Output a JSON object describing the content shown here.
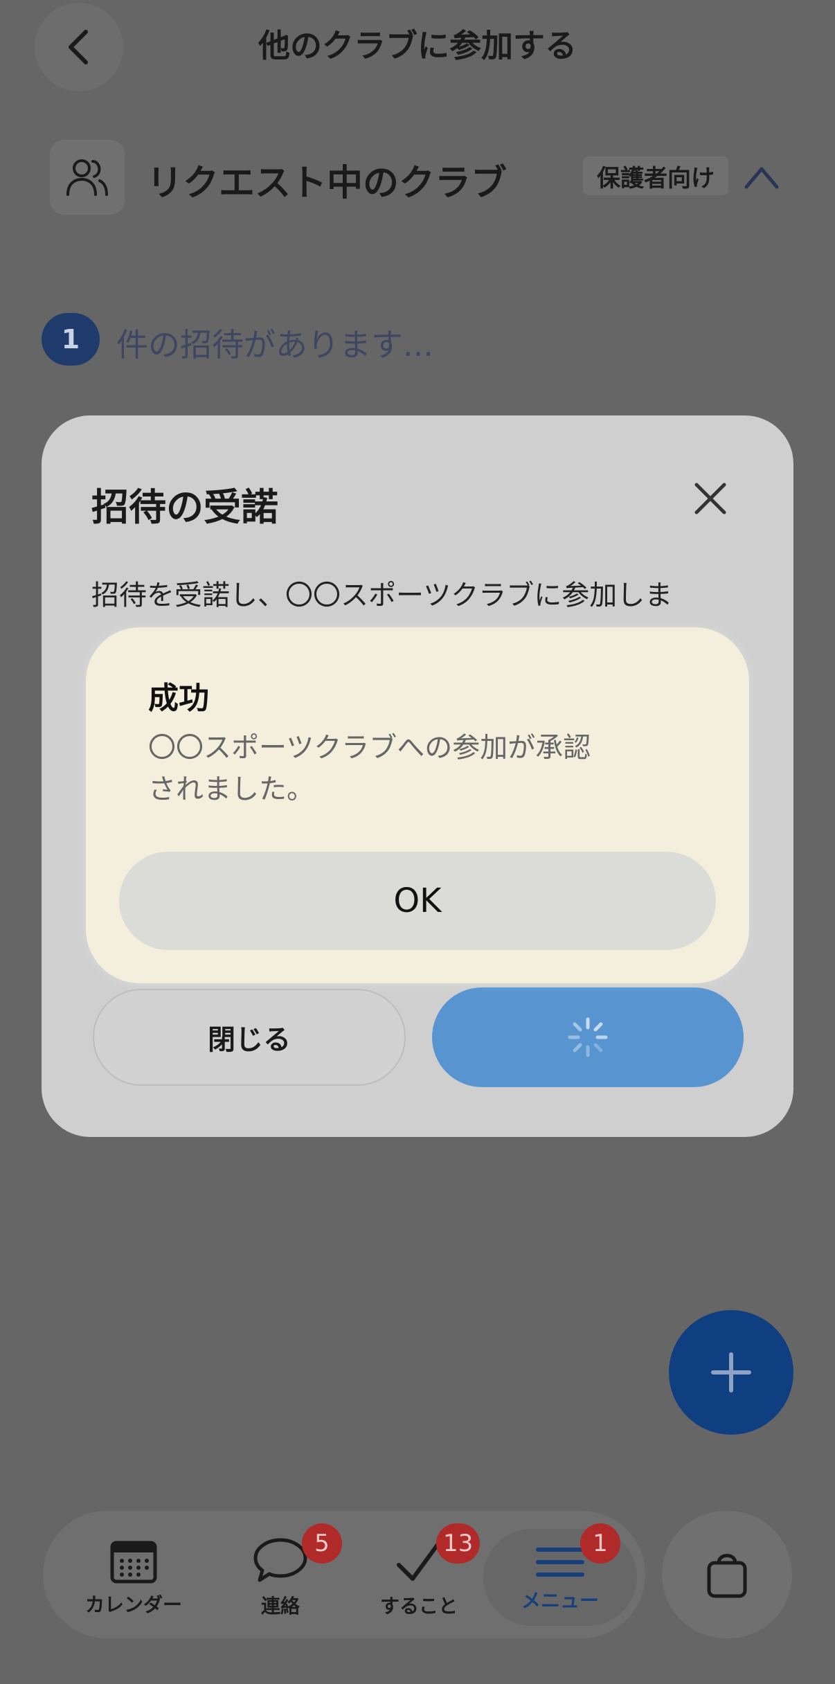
{
  "header": {
    "title": "他のクラブに参加する"
  },
  "section": {
    "title": "リクエスト中のクラブ",
    "badge": "保護者向け"
  },
  "invites": {
    "count": "1",
    "text": "件の招待があります..."
  },
  "dialog": {
    "title": "招待の受諾",
    "body": "招待を受諾し、〇〇スポーツクラブに参加しま",
    "close_label": "閉じる"
  },
  "alert": {
    "title": "成功",
    "message_line1": "〇〇スポーツクラブへの参加が承認",
    "message_line2": "されました。",
    "ok_label": "OK"
  },
  "bottom_nav": {
    "items": [
      {
        "label": "カレンダー",
        "icon": "calendar-icon",
        "badge": ""
      },
      {
        "label": "連絡",
        "icon": "chat-bubble-icon",
        "badge": "5"
      },
      {
        "label": "すること",
        "icon": "checkmark-icon",
        "badge": "13"
      },
      {
        "label": "メニュー",
        "icon": "menu-icon",
        "badge": "1"
      }
    ]
  },
  "colors": {
    "accent": "#0f3f80",
    "accept_button": "#5794d0",
    "badge": "#b02a2a"
  }
}
